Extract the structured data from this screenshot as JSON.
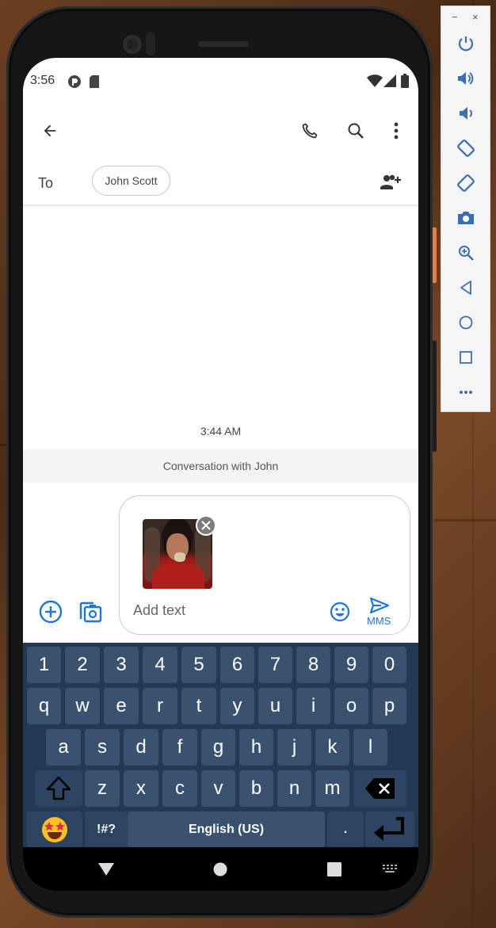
{
  "status_bar": {
    "time": "3:56"
  },
  "header": {
    "back_icon": "arrow-back-icon",
    "call_icon": "phone-icon",
    "search_icon": "search-icon",
    "more_icon": "more-vert-icon"
  },
  "recipients": {
    "to_label": "To",
    "chip": "John Scott",
    "add_people_icon": "group-add-icon"
  },
  "conversation": {
    "timestamp": "3:44 AM",
    "banner": "Conversation with John"
  },
  "compose": {
    "placeholder": "Add text",
    "send_label": "MMS",
    "attachment_alt": "Attached GIF image"
  },
  "keyboard": {
    "row_numbers": [
      "1",
      "2",
      "3",
      "4",
      "5",
      "6",
      "7",
      "8",
      "9",
      "0"
    ],
    "row_1": [
      "q",
      "w",
      "e",
      "r",
      "t",
      "y",
      "u",
      "i",
      "o",
      "p"
    ],
    "row_2": [
      "a",
      "s",
      "d",
      "f",
      "g",
      "h",
      "j",
      "k",
      "l"
    ],
    "row_3": [
      "z",
      "x",
      "c",
      "v",
      "b",
      "n",
      "m"
    ],
    "symbols_label": "!#?",
    "space_label": "English (US)",
    "period_label": "."
  },
  "emulator_panel": {
    "minimize": "−",
    "close": "×",
    "buttons": [
      "power-icon",
      "volume-up-icon",
      "volume-down-icon",
      "rotate-left-icon",
      "rotate-right-icon",
      "camera-icon",
      "zoom-icon",
      "back-icon",
      "home-icon",
      "overview-icon",
      "more-horiz-icon"
    ]
  },
  "colors": {
    "accent": "#1a73e8",
    "keyboard_bg": "#233a55",
    "key_bg": "#3a5270"
  }
}
